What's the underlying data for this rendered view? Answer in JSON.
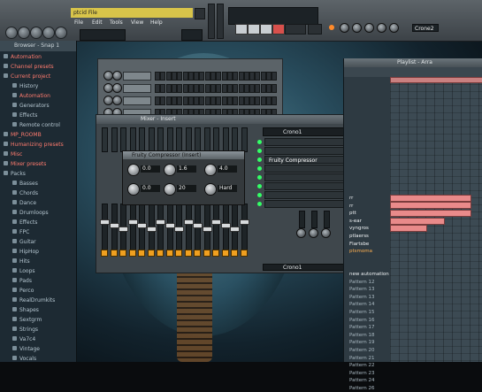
{
  "toolbar": {
    "hint_text": "ptcid File",
    "menu": [
      "File",
      "Edit",
      "Tools",
      "View",
      "Help"
    ],
    "pattern_label": "Crone2",
    "compressor_plugin_field": "Crono1"
  },
  "browser": {
    "title": "Browser - Snap 1",
    "items": [
      {
        "label": "Automation",
        "color": "red"
      },
      {
        "label": "Channel presets",
        "color": "red"
      },
      {
        "label": "Current project",
        "color": "red"
      },
      {
        "label": "History",
        "color": "blue",
        "sub": true
      },
      {
        "label": "Automation",
        "color": "red",
        "sub": true
      },
      {
        "label": "Generators",
        "color": "blue",
        "sub": true
      },
      {
        "label": "Effects",
        "color": "blue",
        "sub": true
      },
      {
        "label": "Remote control",
        "color": "blue",
        "sub": true
      },
      {
        "label": "MP_ROOMB",
        "color": "red"
      },
      {
        "label": "Humanizing presets",
        "color": "red"
      },
      {
        "label": "Misc",
        "color": "red"
      },
      {
        "label": "Mixer presets",
        "color": "red"
      },
      {
        "label": "Packs",
        "color": "blue"
      },
      {
        "label": "Basses",
        "color": "blue",
        "sub": true
      },
      {
        "label": "Chords",
        "color": "blue",
        "sub": true
      },
      {
        "label": "Dance",
        "color": "blue",
        "sub": true
      },
      {
        "label": "Drumloops",
        "color": "blue",
        "sub": true
      },
      {
        "label": "Effects",
        "color": "blue",
        "sub": true
      },
      {
        "label": "FPC",
        "color": "blue",
        "sub": true
      },
      {
        "label": "Guitar",
        "color": "blue",
        "sub": true
      },
      {
        "label": "HipHop",
        "color": "blue",
        "sub": true
      },
      {
        "label": "Hits",
        "color": "blue",
        "sub": true
      },
      {
        "label": "Loops",
        "color": "blue",
        "sub": true
      },
      {
        "label": "Pads",
        "color": "blue",
        "sub": true
      },
      {
        "label": "Perco",
        "color": "blue",
        "sub": true
      },
      {
        "label": "RealDrumkits",
        "color": "blue",
        "sub": true
      },
      {
        "label": "Shapes",
        "color": "blue",
        "sub": true
      },
      {
        "label": "Sextgrm",
        "color": "blue",
        "sub": true
      },
      {
        "label": "Strings",
        "color": "blue",
        "sub": true
      },
      {
        "label": "Va7c4",
        "color": "blue",
        "sub": true
      },
      {
        "label": "Vintage",
        "color": "blue",
        "sub": true
      },
      {
        "label": "Vocals",
        "color": "blue",
        "sub": true
      }
    ]
  },
  "mixer": {
    "title": "Mixer - Insert",
    "master_fx": "Fruity Compressor",
    "bottom_field": "Crono1"
  },
  "compressor": {
    "title": "Fruity Compressor (Insert)",
    "values": [
      "0.0",
      "1.6",
      "4.0",
      "0.0",
      "20",
      "Hard"
    ]
  },
  "playlist": {
    "title": "Playlist - Arra",
    "tracks": [
      {
        "label": "rr",
        "style": "white"
      },
      {
        "label": "rr",
        "style": "white"
      },
      {
        "label": "ptt",
        "style": "white"
      },
      {
        "label": "s-ear",
        "style": "white"
      },
      {
        "label": "vyngros",
        "style": "white"
      },
      {
        "label": "ptlaerss",
        "style": "white"
      },
      {
        "label": "Flartsbe",
        "style": "white"
      },
      {
        "label": "ptsmoma",
        "style": "orange"
      },
      {
        "label": "",
        "style": ""
      },
      {
        "label": "",
        "style": ""
      },
      {
        "label": "new automation",
        "style": "white"
      },
      {
        "label": "Pattern 12",
        "style": ""
      },
      {
        "label": "Pattern 13",
        "style": ""
      },
      {
        "label": "Pattern 13",
        "style": ""
      },
      {
        "label": "Pattern 14",
        "style": ""
      },
      {
        "label": "Pattern 15",
        "style": ""
      },
      {
        "label": "Pattern 16",
        "style": ""
      },
      {
        "label": "Pattern 17",
        "style": ""
      },
      {
        "label": "Pattern 18",
        "style": ""
      },
      {
        "label": "Pattern 19",
        "style": ""
      },
      {
        "label": "Pattern 20",
        "style": ""
      },
      {
        "label": "Pattern 21",
        "style": ""
      },
      {
        "label": "Pattern 22",
        "style": ""
      },
      {
        "label": "Pattern 23",
        "style": ""
      },
      {
        "label": "Pattern 24",
        "style": ""
      },
      {
        "label": "Pattern 26",
        "style": ""
      }
    ]
  }
}
